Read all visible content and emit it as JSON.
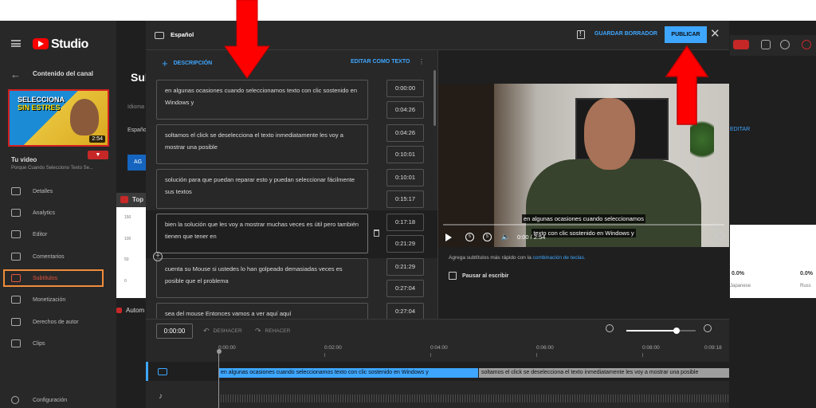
{
  "studio": {
    "logo_text": "Studio",
    "channel_content": "Contenido del canal",
    "page_title": "Sub",
    "thumbnail": {
      "line1": "SELECCIONA",
      "line2": "SIN ESTRES",
      "duration": "2:54"
    },
    "your_video_label": "Tu video",
    "video_title": "Porque Cuando Selecciono Texto Se...",
    "nav": [
      {
        "label": "Detalles"
      },
      {
        "label": "Analytics"
      },
      {
        "label": "Editor"
      },
      {
        "label": "Comentarios"
      },
      {
        "label": "Subtítulos"
      },
      {
        "label": "Monetización"
      },
      {
        "label": "Derechos de autor"
      },
      {
        "label": "Clips"
      }
    ],
    "settings_label": "Configuración",
    "bg_idioma": "Idioma",
    "bg_espanol": "Español",
    "bg_blue_btn": "AG",
    "bg_chart_label": "Top",
    "bg_yticks": [
      "150",
      "100",
      "50",
      "0"
    ],
    "bg_auto_label": "Autom",
    "bg_editar": "EDITAR",
    "bg_pct": [
      "0.0%",
      "0.0%"
    ],
    "bg_lang": [
      "Japanese",
      "Russ"
    ]
  },
  "dialog": {
    "title": "Español",
    "save_draft": "GUARDAR BORRADOR",
    "publish": "PUBLICAR",
    "add_description": "DESCRIPCIÓN",
    "edit_as_text": "EDITAR COMO TEXTO",
    "segments": [
      {
        "text": "en algunas ocasiones cuando seleccionamos texto con clic sostenido en Windows y",
        "start": "0:00:00",
        "end": "0:04:26"
      },
      {
        "text": "soltamos el click se deselecciona el texto inmediatamente les voy a mostrar una posible",
        "start": "0:04:26",
        "end": "0:10:01"
      },
      {
        "text": "solución para que puedan reparar esto y puedan seleccionar fácilmente sus textos",
        "start": "0:10:01",
        "end": "0:15:17"
      },
      {
        "text": "bien la solución que les voy a mostrar muchas veces es útil pero también tienen que tener en",
        "start": "0:17:18",
        "end": "0:21:29"
      },
      {
        "text": "cuenta su Mouse si ustedes lo han golpeado demasiadas veces es posible que el problema",
        "start": "0:21:29",
        "end": "0:27:04"
      },
      {
        "text": "sea del mouse Entonces vamos a ver aquí aquí",
        "start": "0:27:04",
        "end": ""
      }
    ],
    "video": {
      "caption_line1": "en algunas ocasiones cuando seleccionamos",
      "caption_line2": "texto con clic sostenido en Windows y",
      "time": "0:00 / 2:54",
      "rewind_label": "5",
      "forward_label": "5"
    },
    "tip_text": "Agrega subtítulos más rápido con la",
    "tip_link": "combinación de teclas.",
    "pause_label": "Pausar al escribir",
    "timeline": {
      "current_time": "0:00:00",
      "undo": "DESHACER",
      "redo": "REHACER",
      "zoom_level": 0.72,
      "ticks": [
        "0:00:00",
        "0:02:00",
        "0:04:00",
        "0:06:00",
        "0:08:00",
        "0:09:18"
      ],
      "cap_segment_1": "en algunas ocasiones cuando seleccionamos  texto con clic sostenido en Windows y",
      "cap_segment_2": "soltamos el click se deselecciona el texto  inmediatamente les voy a mostrar una posible"
    }
  },
  "colors": {
    "accent": "#3ea6ff",
    "arrow": "#ff0000",
    "highlight_box": "#f08c3a"
  }
}
